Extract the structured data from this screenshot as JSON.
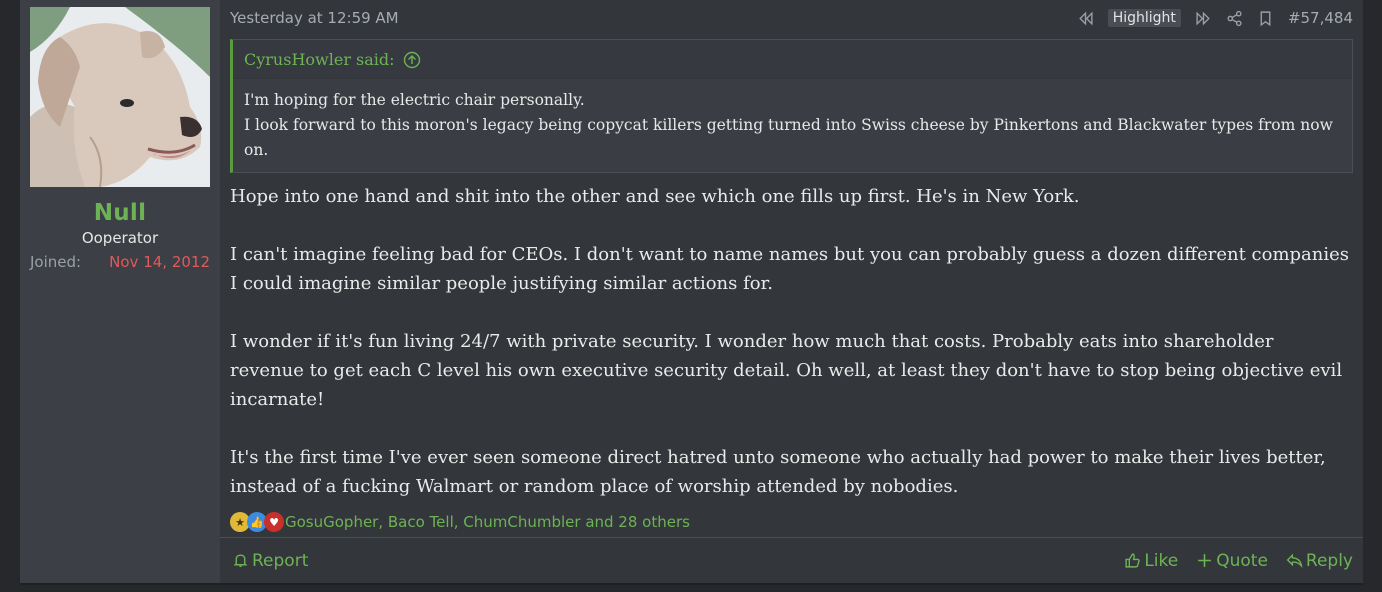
{
  "user": {
    "name": "Null",
    "title": "Ooperator",
    "joined_label": "Joined:",
    "joined_value": "Nov 14, 2012"
  },
  "header": {
    "date": "Yesterday at 12:59 AM",
    "highlight_label": "Highlight",
    "post_number": "#57,484"
  },
  "quote": {
    "author": "CyrusHowler said:",
    "lines": [
      "I'm hoping for the electric chair personally.",
      "I look forward to this moron's legacy being copycat killers getting turned into Swiss cheese by Pinkertons and Blackwater types from now on."
    ]
  },
  "message": {
    "paragraphs": [
      "Hope into one hand and shit into the other and see which one fills up first. He's in New York.",
      "I can't imagine feeling bad for CEOs. I don't want to name names but you can probably guess a dozen different companies I could imagine similar people justifying similar actions for.",
      "I wonder if it's fun living 24/7 with private security. I wonder how much that costs. Probably eats into shareholder revenue to get each C level his own executive security detail. Oh well, at least they don't have to stop being objective evil incarnate!",
      "It's the first time I've ever seen someone direct hatred unto someone who actually had power to make their lives better, instead of a fucking Walmart or random place of worship attended by nobodies."
    ]
  },
  "reactions": {
    "icons": [
      "medal-icon",
      "thumbs-up-icon",
      "heart-icon"
    ],
    "names": "GosuGopher, Baco Tell, ChumChumbler and 28 others"
  },
  "footer": {
    "report_label": "Report",
    "like_label": "Like",
    "quote_label": "Quote",
    "reply_label": "Reply"
  },
  "colors": {
    "accent_green": "#6db355",
    "joined_red": "#e05a5a",
    "post_bg": "#33363b",
    "user_cell_bg": "#3c3f45"
  }
}
